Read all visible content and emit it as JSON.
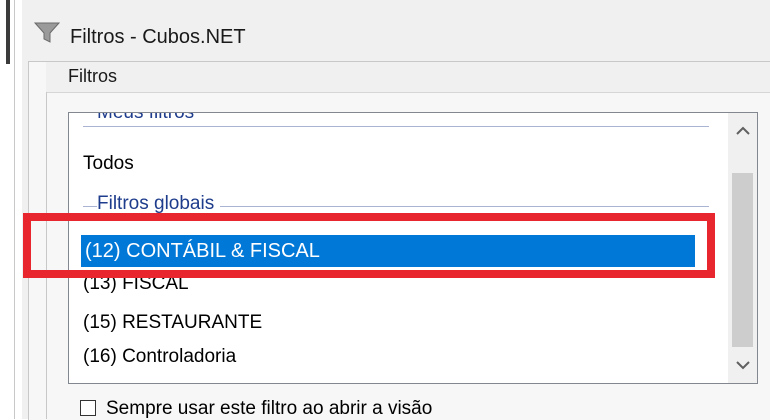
{
  "window": {
    "title": "Filtros - Cubos.NET",
    "icon": "funnel-icon"
  },
  "group": {
    "label": "Filtros"
  },
  "list": {
    "group_meus": "Meus filtros",
    "item_todos": "Todos",
    "group_globais": "Filtros globais",
    "items": [
      "(12) CONTÁBIL & FISCAL",
      "(13) FISCAL",
      "(15) RESTAURANTE",
      "(16) Controladoria"
    ],
    "selected_index": 0
  },
  "scrollbar": {
    "up_glyph": "^",
    "down_glyph": "v"
  },
  "checkbox": {
    "label": "Sempre usar este filtro ao abrir a visão",
    "checked": false
  },
  "colors": {
    "selection": "#0078d7",
    "highlight_box": "#e8262e",
    "group_text": "#1e3c8c"
  }
}
